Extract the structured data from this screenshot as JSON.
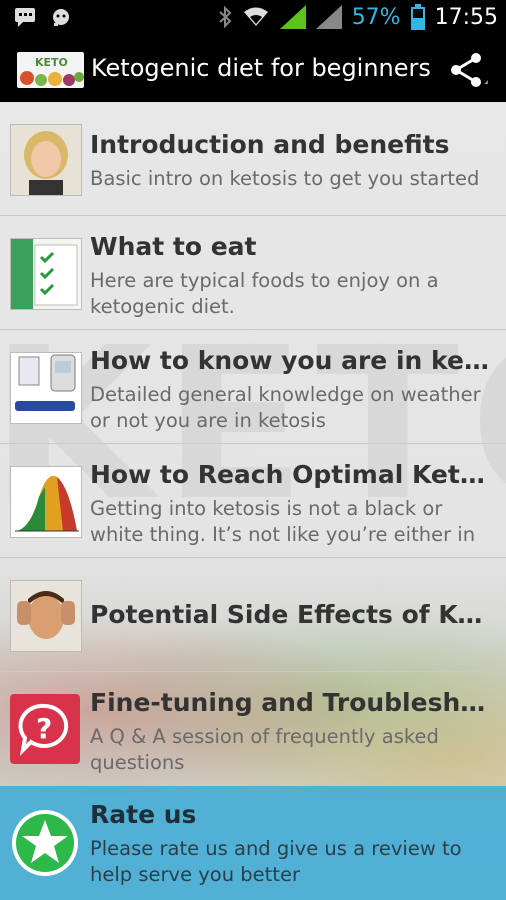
{
  "status": {
    "battery_pct": "57%",
    "time": "17:55"
  },
  "app": {
    "logo_text": "KETO",
    "title": "Ketogenic diet for beginners"
  },
  "items": [
    {
      "title": "Introduction and benefits",
      "subtitle": "Basic intro on ketosis to get you started"
    },
    {
      "title": "What to eat",
      "subtitle": "Here are typical foods to enjoy on a ketogenic diet."
    },
    {
      "title": "How to know you are in ketosis",
      "subtitle": "Detailed general knowledge on weather or not you are in ketosis"
    },
    {
      "title": "How to Reach Optimal Ketosis",
      "subtitle": "Getting into ketosis is not a black or white thing. It’s not like you’re either in"
    },
    {
      "title": "Potential Side Effects of Keto…",
      "subtitle": ""
    },
    {
      "title": "Fine-tuning and Troubleshooti…",
      "subtitle": "A Q & A  session of frequently asked questions"
    }
  ],
  "rate": {
    "title": "Rate us",
    "subtitle": "Please rate us and give us a review to help serve you better"
  },
  "colors": {
    "accent": "#33b5e5",
    "rate_bg": "#3caad7",
    "star": "#2db84a"
  }
}
